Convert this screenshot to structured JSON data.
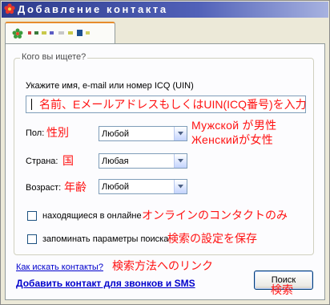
{
  "window": {
    "title": "Добавление контакта"
  },
  "tab": {
    "icon": "flower-icon",
    "colors": [
      "#d04040",
      "#3a7a3a",
      "#c9c94a",
      "#5b5bc4",
      "#c7c7c7",
      "#1d4f91",
      "#cfcf60"
    ]
  },
  "group": {
    "legend": "Кого вы ищете?"
  },
  "search": {
    "prompt": "Укажите имя, e-mail или номер ICQ (UIN)",
    "value": "名前、Eメールアドレスもしくは​UIN(ICQ番号)を入力"
  },
  "gender": {
    "label": "Пол:",
    "note": "性別",
    "value": "Любой",
    "note_options_1": "Мужской が男性",
    "note_options_2": "Женскийが女性"
  },
  "country": {
    "label": "Страна:",
    "note": "国",
    "value": "Любая"
  },
  "age": {
    "label": "Возраст:",
    "note": "年齢",
    "value": "Любой"
  },
  "online_only": {
    "label": "находящиеся в онлайне",
    "note": "オンラインのコンタクトのみ",
    "checked": false
  },
  "remember": {
    "label": "запоминать параметры поиска",
    "note": "検索の設定を保存",
    "checked": false
  },
  "help_link": {
    "label": "Как искать контакты?",
    "note": "検索方法へのリンク"
  },
  "add_phone_link": {
    "label": "Добавить контакт для звонков и SMS"
  },
  "search_button": {
    "label": "Поиск",
    "note": "検索"
  },
  "accent": {
    "title_bar": "#3a4a9e",
    "annotation_text": "#ff1111",
    "tab_highlight": "#e68b2c",
    "link": "#0000cc"
  }
}
